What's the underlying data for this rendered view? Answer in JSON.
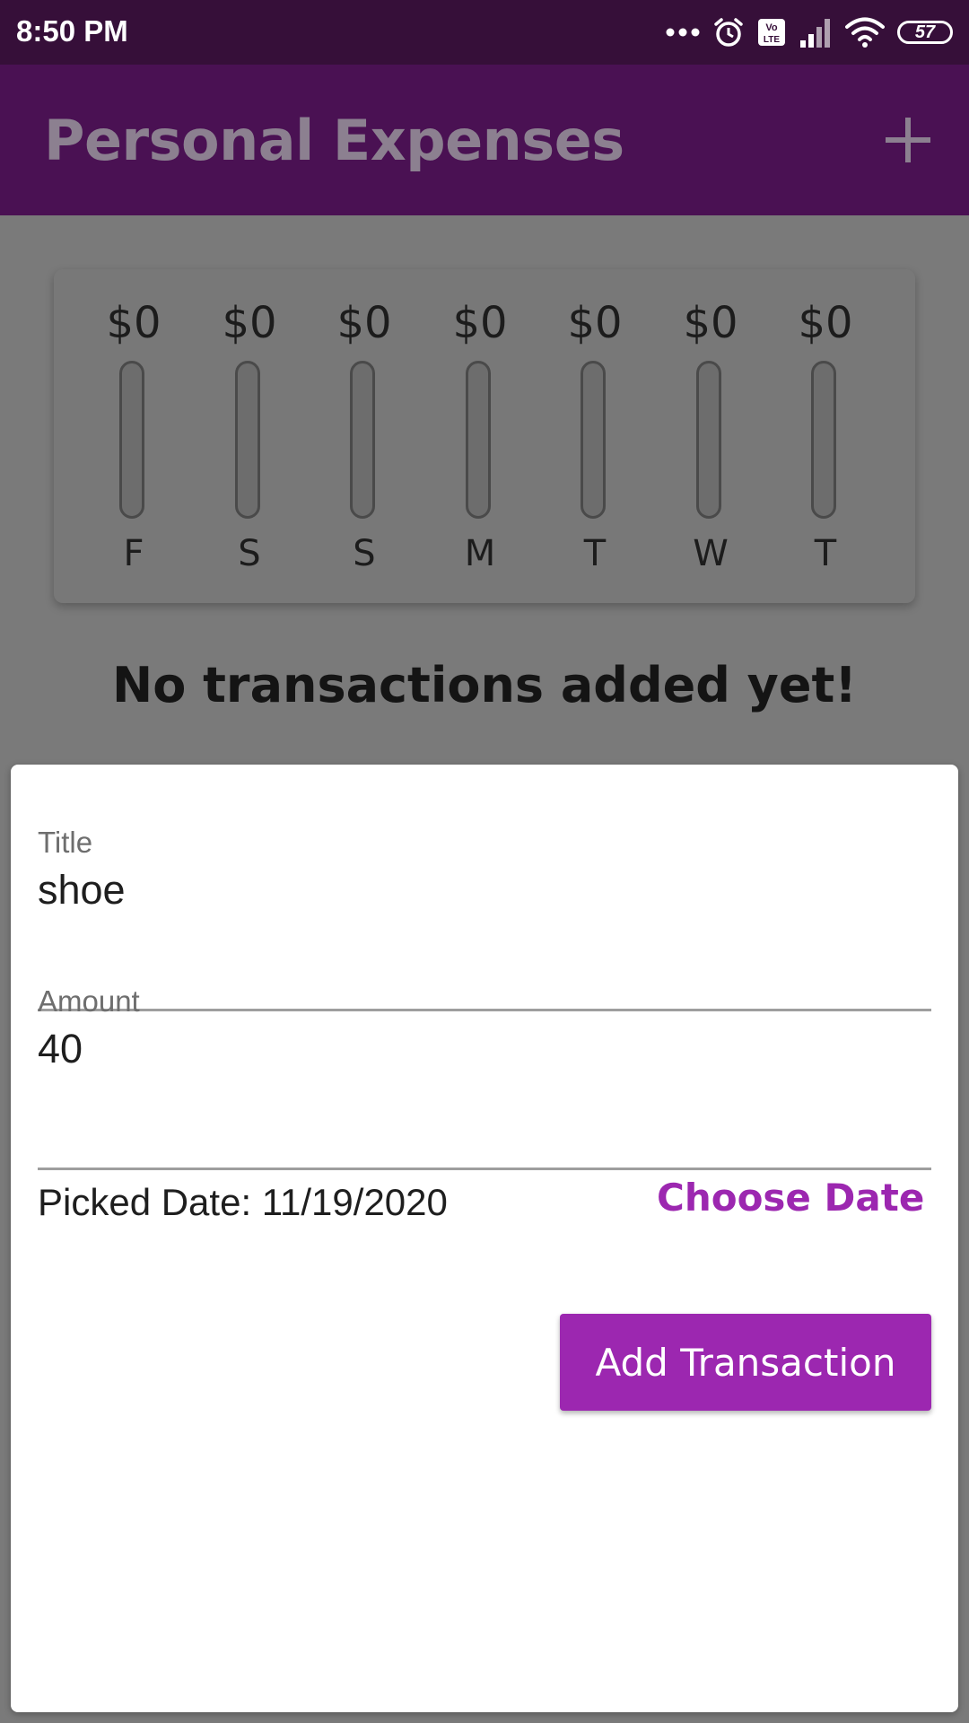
{
  "status_bar": {
    "time": "8:50 PM",
    "battery": "57",
    "icons": [
      "more-dots-icon",
      "alarm-icon",
      "volte-icon",
      "signal-icon",
      "wifi-icon",
      "battery-icon"
    ]
  },
  "app_bar": {
    "title": "Personal Expenses",
    "add_icon": "plus-icon"
  },
  "chart_data": {
    "type": "bar",
    "categories": [
      "F",
      "S",
      "S",
      "M",
      "T",
      "W",
      "T"
    ],
    "amount_labels": [
      "$0",
      "$0",
      "$0",
      "$0",
      "$0",
      "$0",
      "$0"
    ],
    "values": [
      0,
      0,
      0,
      0,
      0,
      0,
      0
    ],
    "fill_fraction": [
      0,
      0,
      0,
      0,
      0,
      0,
      0
    ]
  },
  "empty_message": "No transactions added yet!",
  "form": {
    "title_label": "Title",
    "title_value": "shoe",
    "amount_label": "Amount",
    "amount_value": "40",
    "picked_date": "Picked Date: 11/19/2020",
    "choose_date_label": "Choose Date",
    "submit_label": "Add Transaction"
  },
  "colors": {
    "primary": "#9c27b0",
    "app_bar": "#4a1153",
    "status_bar": "#360f39"
  }
}
